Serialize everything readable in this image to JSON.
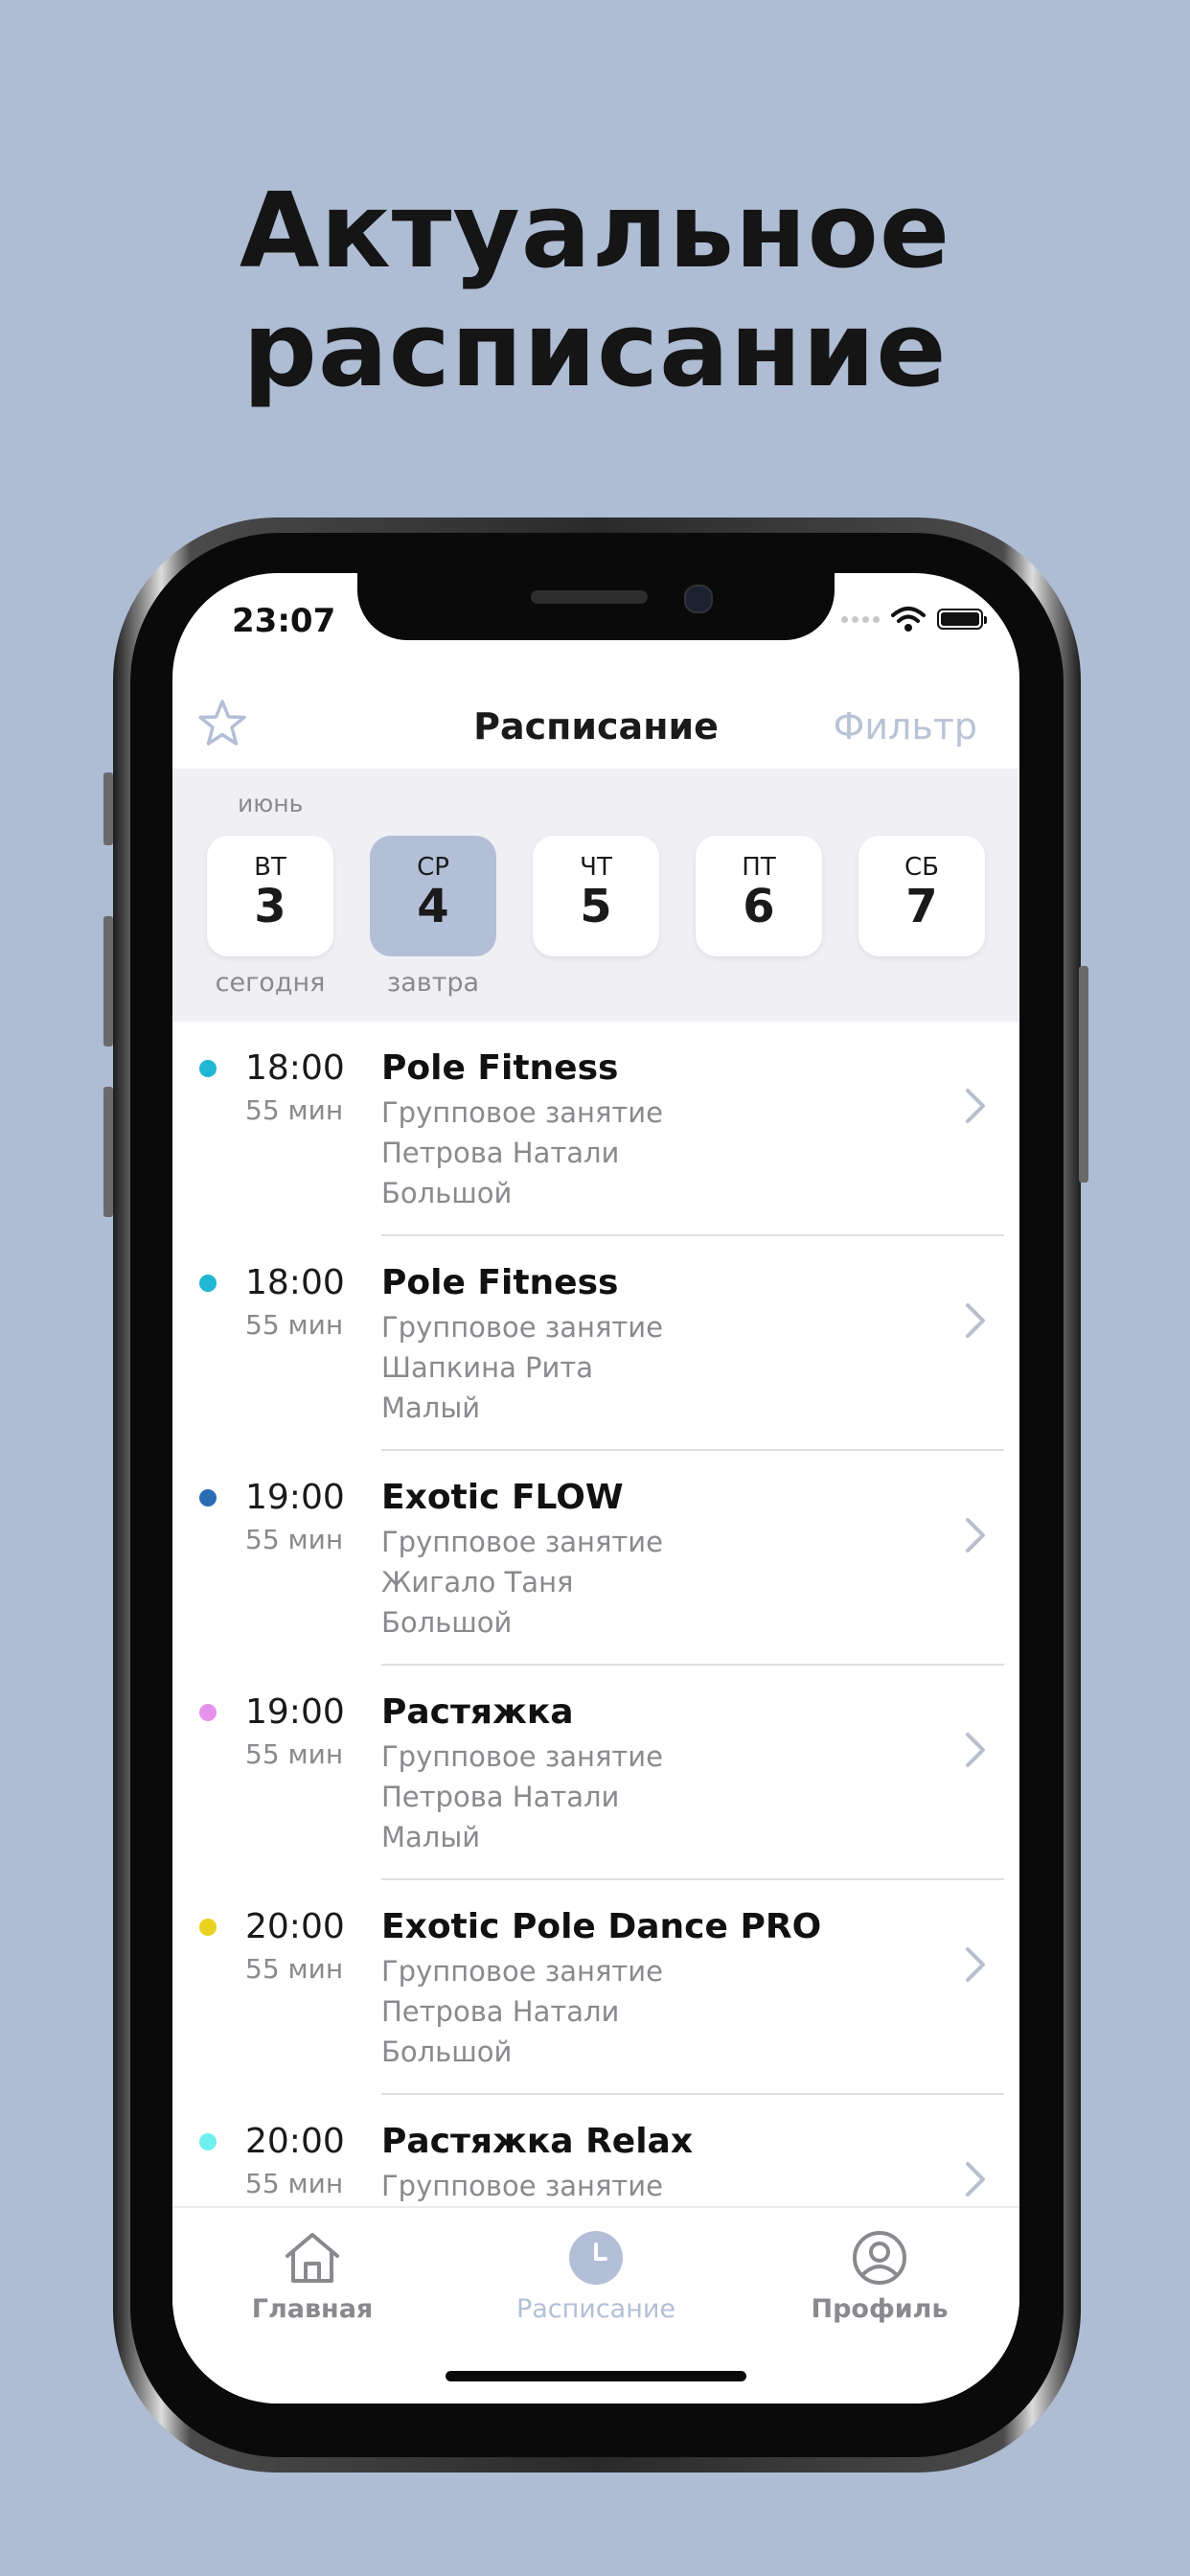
{
  "promo": {
    "line1": "Актуальное",
    "line2": "расписание"
  },
  "status_bar": {
    "time": "23:07"
  },
  "header": {
    "title": "Расписание",
    "filter_label": "Фильтр",
    "favorites_icon": "star-icon"
  },
  "calendar": {
    "month": "июнь",
    "days": [
      {
        "weekday": "ВТ",
        "number": "3",
        "note": "сегодня",
        "selected": false
      },
      {
        "weekday": "СР",
        "number": "4",
        "note": "завтра",
        "selected": true
      },
      {
        "weekday": "ЧТ",
        "number": "5",
        "note": "",
        "selected": false
      },
      {
        "weekday": "ПТ",
        "number": "6",
        "note": "",
        "selected": false
      },
      {
        "weekday": "СБ",
        "number": "7",
        "note": "",
        "selected": false
      }
    ]
  },
  "schedule": [
    {
      "time": "18:00",
      "duration": "55 мин",
      "title": "Pole Fitness",
      "type": "Групповое занятие",
      "trainer": "Петрова Натали",
      "hall": "Большой",
      "color": "#1fb7d4"
    },
    {
      "time": "18:00",
      "duration": "55 мин",
      "title": "Pole Fitness",
      "type": "Групповое занятие",
      "trainer": "Шапкина Рита",
      "hall": "Малый",
      "color": "#1fb7d4"
    },
    {
      "time": "19:00",
      "duration": "55 мин",
      "title": "Exotic FLOW",
      "type": "Групповое занятие",
      "trainer": "Жигало Таня",
      "hall": "Большой",
      "color": "#2a6db5"
    },
    {
      "time": "19:00",
      "duration": "55 мин",
      "title": "Растяжка",
      "type": "Групповое занятие",
      "trainer": "Петрова Натали",
      "hall": "Малый",
      "color": "#e592ea"
    },
    {
      "time": "20:00",
      "duration": "55 мин",
      "title": "Exotic Pole Dance PRO",
      "type": "Групповое занятие",
      "trainer": "Петрова Натали",
      "hall": "Большой",
      "color": "#e8d21e"
    },
    {
      "time": "20:00",
      "duration": "55 мин",
      "title": "Растяжка Relax",
      "type": "Групповое занятие",
      "trainer": "",
      "hall": "",
      "color": "#6ff0ee"
    }
  ],
  "tabbar": {
    "tabs": [
      {
        "label": "Главная",
        "icon": "home-icon",
        "active": false
      },
      {
        "label": "Расписание",
        "icon": "clock-icon",
        "active": true
      },
      {
        "label": "Профиль",
        "icon": "profile-icon",
        "active": false
      }
    ]
  },
  "colors": {
    "background": "#aebcd4",
    "accent": "#b3bfd7",
    "muted": "#8a8a8e"
  }
}
